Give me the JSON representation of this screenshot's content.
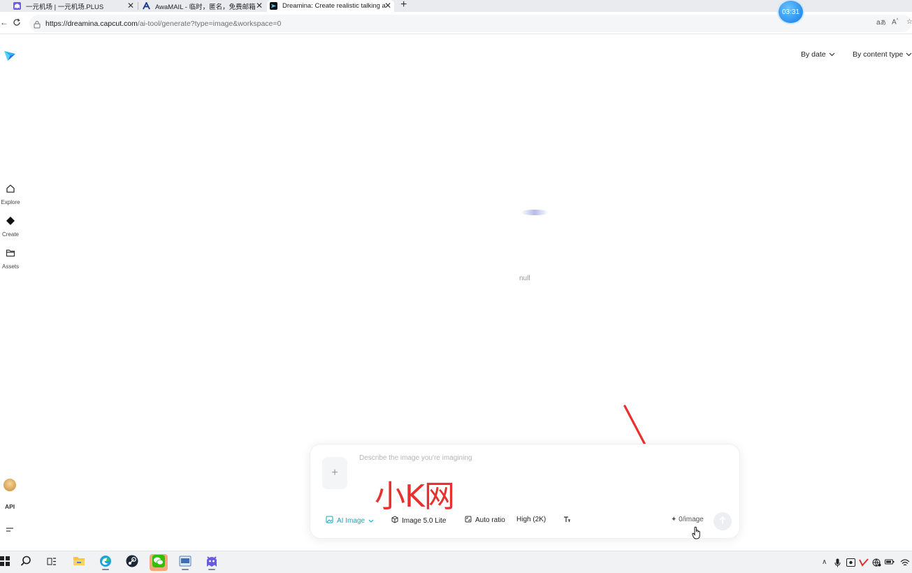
{
  "browser": {
    "tabs": [
      {
        "title": "一元机场 | 一元机场.PLUS",
        "close": "✕"
      },
      {
        "title": "AwaMAIL - 临时，匿名，免费邮箱",
        "close": "✕"
      },
      {
        "title": "Dreamina: Create realistic talking a",
        "close": "✕"
      }
    ],
    "new_tab": "+",
    "url_host": "https://dreamina.capcut.com",
    "url_path": "/ai-tool/generate?type=image&workspace=0",
    "timer": "03:31"
  },
  "app": {
    "sort": {
      "by_date": "By date",
      "by_content_type": "By content type"
    },
    "nav": [
      {
        "label": "Explore",
        "icon": "home-icon"
      },
      {
        "label": "Create",
        "icon": "diamond-icon"
      },
      {
        "label": "Assets",
        "icon": "folder-icon"
      }
    ],
    "api_label": "API",
    "empty_state": "null",
    "prompt": {
      "placeholder": "Describe the image you're imagining",
      "watermark": "小K网",
      "mode": "AI Image",
      "model": "Image 5.0 Lite",
      "ratio": "Auto ratio",
      "quality": "High (2K)",
      "credits": "0/image"
    }
  },
  "colors": {
    "accent": "#14a6c4",
    "annotation_red": "#e8312e",
    "taskbar_active": "#f4a97a"
  }
}
